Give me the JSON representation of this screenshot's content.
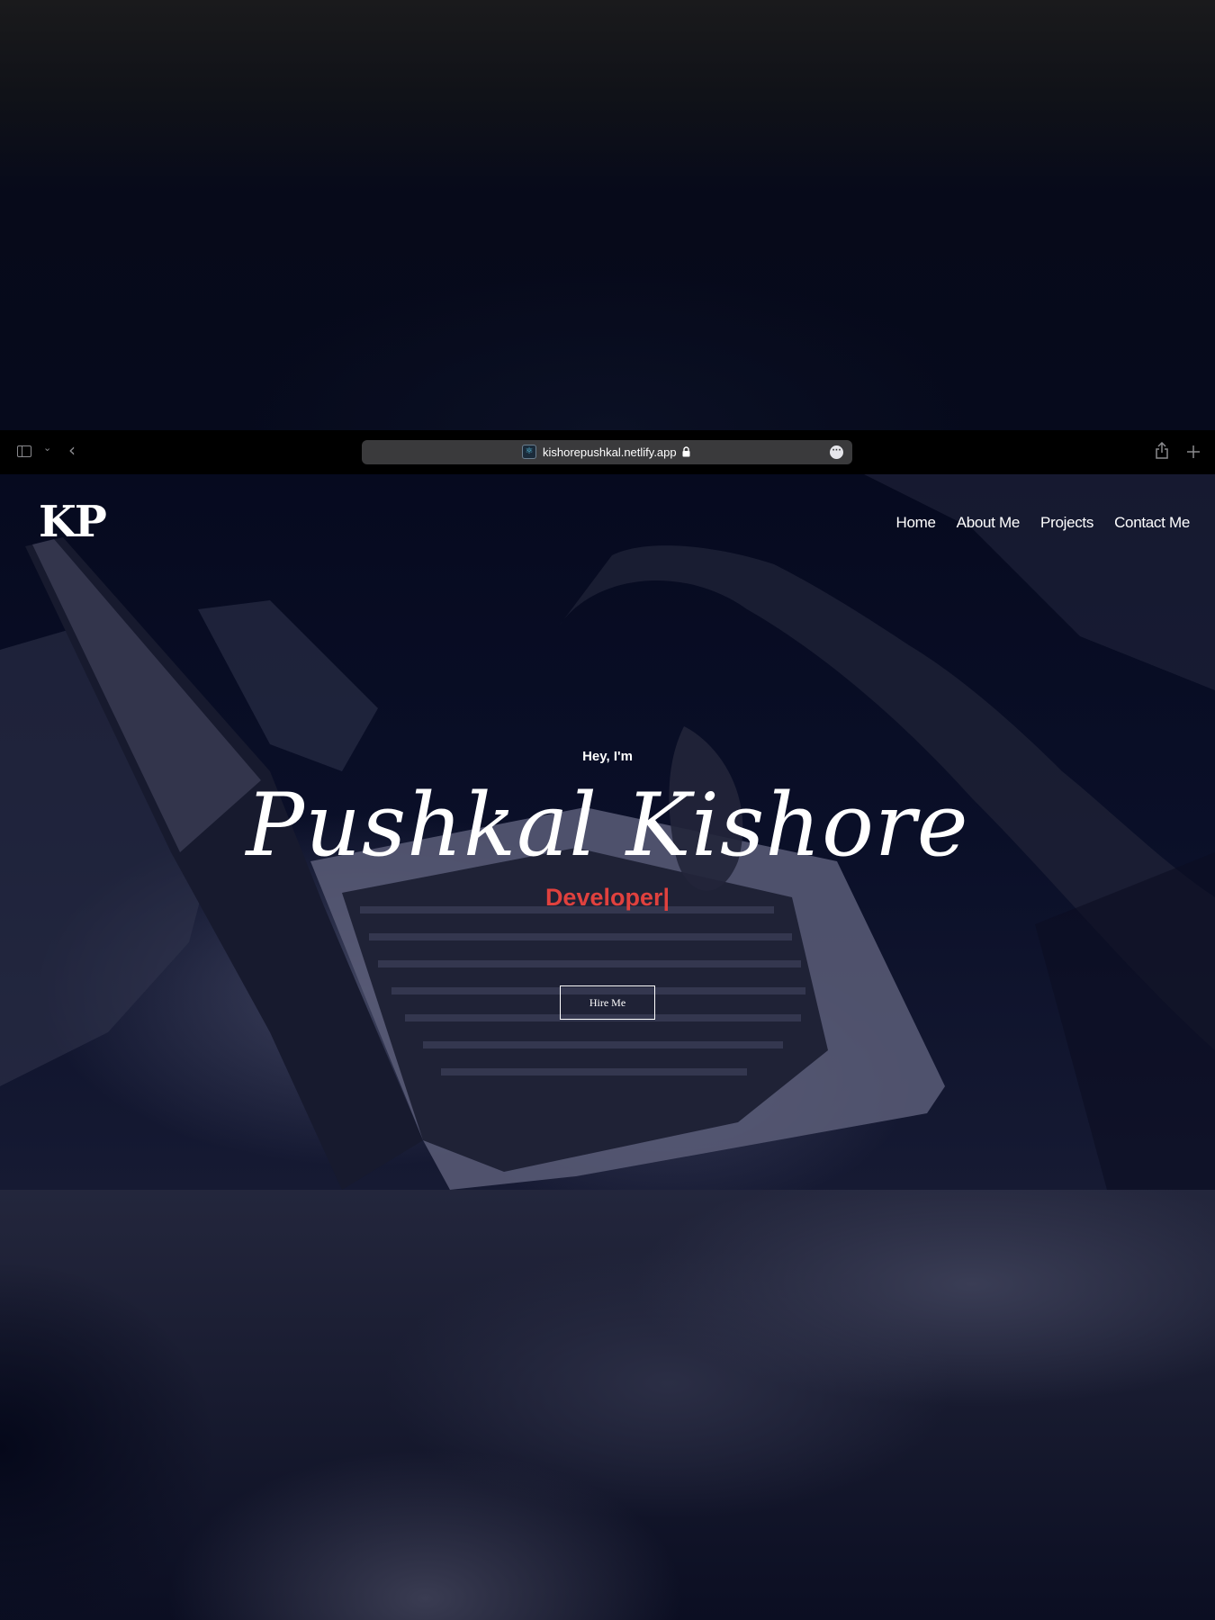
{
  "browser": {
    "url": "kishorepushkal.netlify.app",
    "icons": {
      "sidebar": "sidebar-toggle-icon",
      "tab_overview": "chevron-down-icon",
      "back": "back-chevron-icon",
      "favicon": "react-atom-icon",
      "secure": "lock-icon",
      "page_menu": "more-icon",
      "share": "share-icon",
      "new_tab": "plus-icon"
    }
  },
  "site": {
    "logo": "KP",
    "nav": [
      "Home",
      "About Me",
      "Projects",
      "Contact Me"
    ]
  },
  "hero": {
    "greeting": "Hey, I'm",
    "name": "Pushkal Kishore",
    "role": "Developer|",
    "cta": "Hire Me"
  },
  "colors": {
    "accent": "#e0413e",
    "overlay": "#060a1f",
    "text": "#ffffff"
  }
}
